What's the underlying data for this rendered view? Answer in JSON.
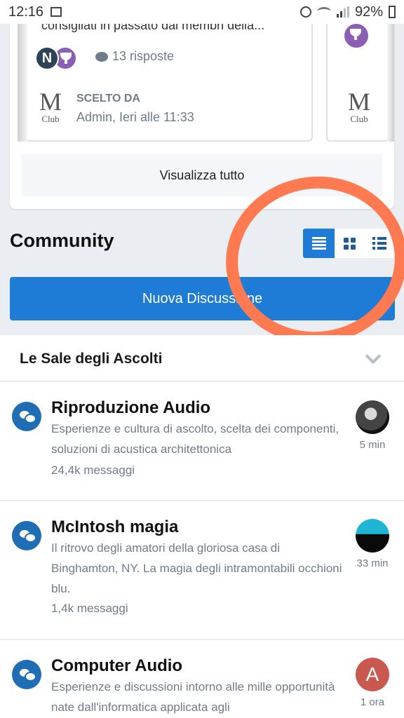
{
  "status_bar": {
    "time": "12:16",
    "battery": "92%"
  },
  "top_card": {
    "cut_text": "consigliati in passato dai membri della...",
    "avatar_letter": "N",
    "replies": "13 risposte",
    "logo_letter": "M",
    "logo_sub": "Club",
    "chosen_label": "SCELTO DA",
    "chosen_by": "Admin, Ieri alle 11:33",
    "view_all": "Visualizza tutto"
  },
  "community": {
    "title": "Community",
    "new_discussion": "Nuova Discussione"
  },
  "section": {
    "title": "Le Sale degli Ascolti"
  },
  "forums": [
    {
      "title": "Riproduzione Audio",
      "description": "Esperienze e cultura di ascolto, scelta dei componenti, soluzioni di acustica architettonica",
      "count": "24,4k messaggi",
      "time": "5 min"
    },
    {
      "title": "McIntosh magia",
      "description": "Il ritrovo degli amatori della gloriosa casa di Binghamton, NY. La magia degli intramontabili occhioni blu.",
      "count": "1,4k messaggi",
      "time": "33 min"
    },
    {
      "title": "Computer Audio",
      "description": "Esperienze e discussioni intorno alle mille opportunità nate dall'informatica applicata agli",
      "avatar_letter": "A",
      "time": "1 ora"
    }
  ],
  "colors": {
    "accent": "#1e7bd6",
    "highlight": "#ff7a50",
    "muted": "#6f7c89"
  }
}
